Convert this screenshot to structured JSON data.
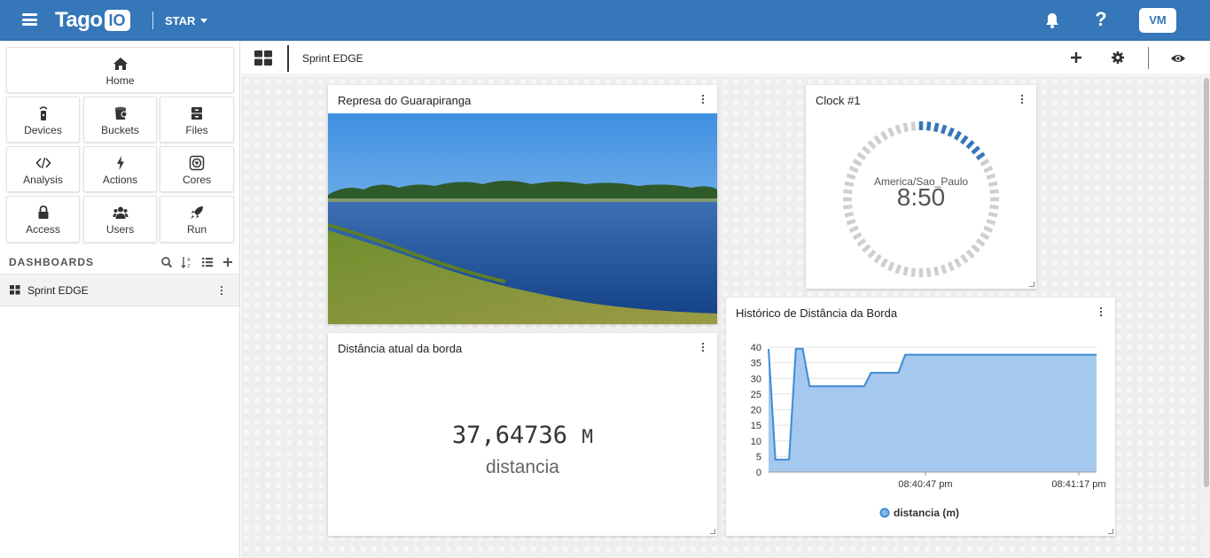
{
  "topbar": {
    "logo_text": "Tago",
    "logo_badge": "IO",
    "profile_name": "STAR",
    "avatar_initials": "VM",
    "help_label": "?"
  },
  "sidebar": {
    "tiles": [
      {
        "label": "Home",
        "icon": "home-icon"
      },
      {
        "label": "Devices",
        "icon": "device-icon"
      },
      {
        "label": "Buckets",
        "icon": "bucket-icon"
      },
      {
        "label": "Files",
        "icon": "files-icon"
      },
      {
        "label": "Analysis",
        "icon": "code-icon"
      },
      {
        "label": "Actions",
        "icon": "bolt-icon"
      },
      {
        "label": "Cores",
        "icon": "cores-icon"
      },
      {
        "label": "Access",
        "icon": "lock-icon"
      },
      {
        "label": "Users",
        "icon": "users-icon"
      },
      {
        "label": "Run",
        "icon": "rocket-icon"
      }
    ],
    "dashboards_title": "DASHBOARDS",
    "dashboards": [
      {
        "name": "Sprint EDGE"
      }
    ]
  },
  "toolbar": {
    "dashboard_name": "Sprint EDGE"
  },
  "widgets": {
    "image": {
      "title": "Represa do Guarapiranga"
    },
    "display": {
      "title": "Distância atual da borda",
      "value": "37,64736",
      "unit": "M",
      "label": "distancia"
    },
    "clock": {
      "title": "Clock #1",
      "timezone": "America/Sao_Paulo",
      "time": "8:50"
    },
    "chart": {
      "title": "Histórico de Distância da Borda"
    }
  },
  "colors": {
    "brand": "#3577b8",
    "chart_line": "#3d8ad6",
    "chart_fill": "#a5c8ef",
    "clock_active": "#3577b8",
    "clock_inactive": "#cfcfcf"
  },
  "chart_data": {
    "type": "area",
    "title": "Histórico de Distância da Borda",
    "x_tick_labels": [
      "08:40:47 pm",
      "08:41:17 pm"
    ],
    "ylim": [
      0,
      40
    ],
    "y_ticks": [
      0,
      5,
      10,
      15,
      20,
      25,
      30,
      35,
      40
    ],
    "grid": true,
    "legend_position": "bottom",
    "series": [
      {
        "name": "distancia (m)",
        "points": [
          [
            0,
            39.5
          ],
          [
            1,
            4
          ],
          [
            3,
            4
          ],
          [
            4,
            39.5
          ],
          [
            5,
            39.5
          ],
          [
            6,
            27.5
          ],
          [
            14,
            27.5
          ],
          [
            15,
            31.8
          ],
          [
            19,
            31.8
          ],
          [
            20,
            37.6
          ],
          [
            48,
            37.6
          ]
        ]
      }
    ]
  }
}
